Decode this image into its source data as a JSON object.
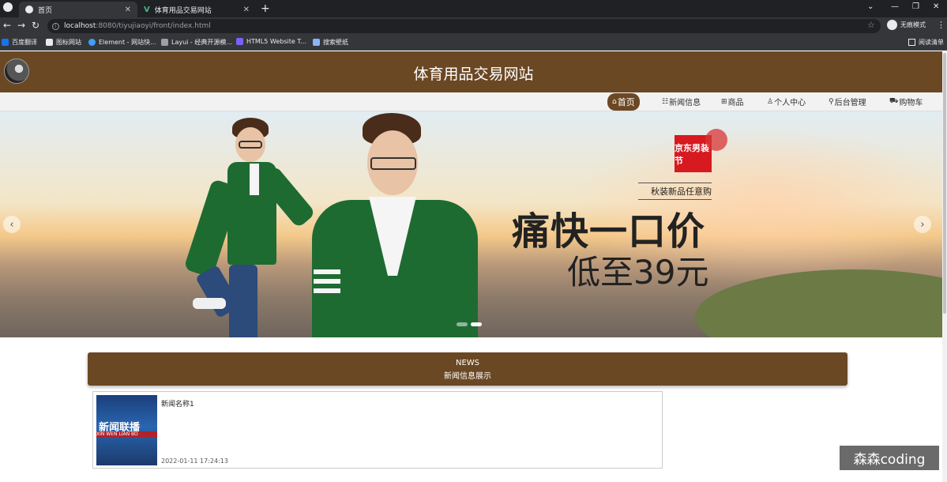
{
  "browser": {
    "tabs": [
      {
        "label": "首页",
        "active": true
      },
      {
        "label": "体育用品交易网站",
        "active": false
      }
    ],
    "new_tab": "+",
    "url_host": "localhost",
    "url_rest": ":8080/tiyujiaoyi/front/index.html",
    "profile_label": "无痕模式",
    "bookmarks": [
      "百度翻译",
      "图标网站",
      "Element - 网站快...",
      "Layui - 经典开源模...",
      "HTML5 Website T...",
      "搜索壁纸"
    ],
    "reading_list": "阅读清单"
  },
  "site": {
    "title": "体育用品交易网站",
    "nav": [
      {
        "icon": "⌂",
        "label": "首页",
        "active": true
      },
      {
        "icon": "☷",
        "label": "新闻信息",
        "active": false
      },
      {
        "icon": "⊞",
        "label": "商品",
        "active": false
      },
      {
        "icon": "♙",
        "label": "个人中心",
        "active": false
      },
      {
        "icon": "⚲",
        "label": "后台管理",
        "active": false
      },
      {
        "icon": "⛟",
        "label": "购物车",
        "active": false
      }
    ]
  },
  "banner": {
    "brand": "京东男装节",
    "subtitle": "秋装新品任意购",
    "headline": "痛快一口价",
    "price": "低至39元"
  },
  "news": {
    "title_en": "NEWS",
    "title_cn": "新闻信息展示",
    "items": [
      {
        "title": "新闻名称1",
        "time": "2022-01-11 17:24:13",
        "thumb_text": "新闻联播",
        "thumb_pinyin": "XIN WEN LIAN BO"
      }
    ]
  },
  "watermark": "森森coding",
  "colors": {
    "brand": "#6b4824",
    "chrome_dark": "#202124",
    "chrome_bar": "#35363a"
  }
}
